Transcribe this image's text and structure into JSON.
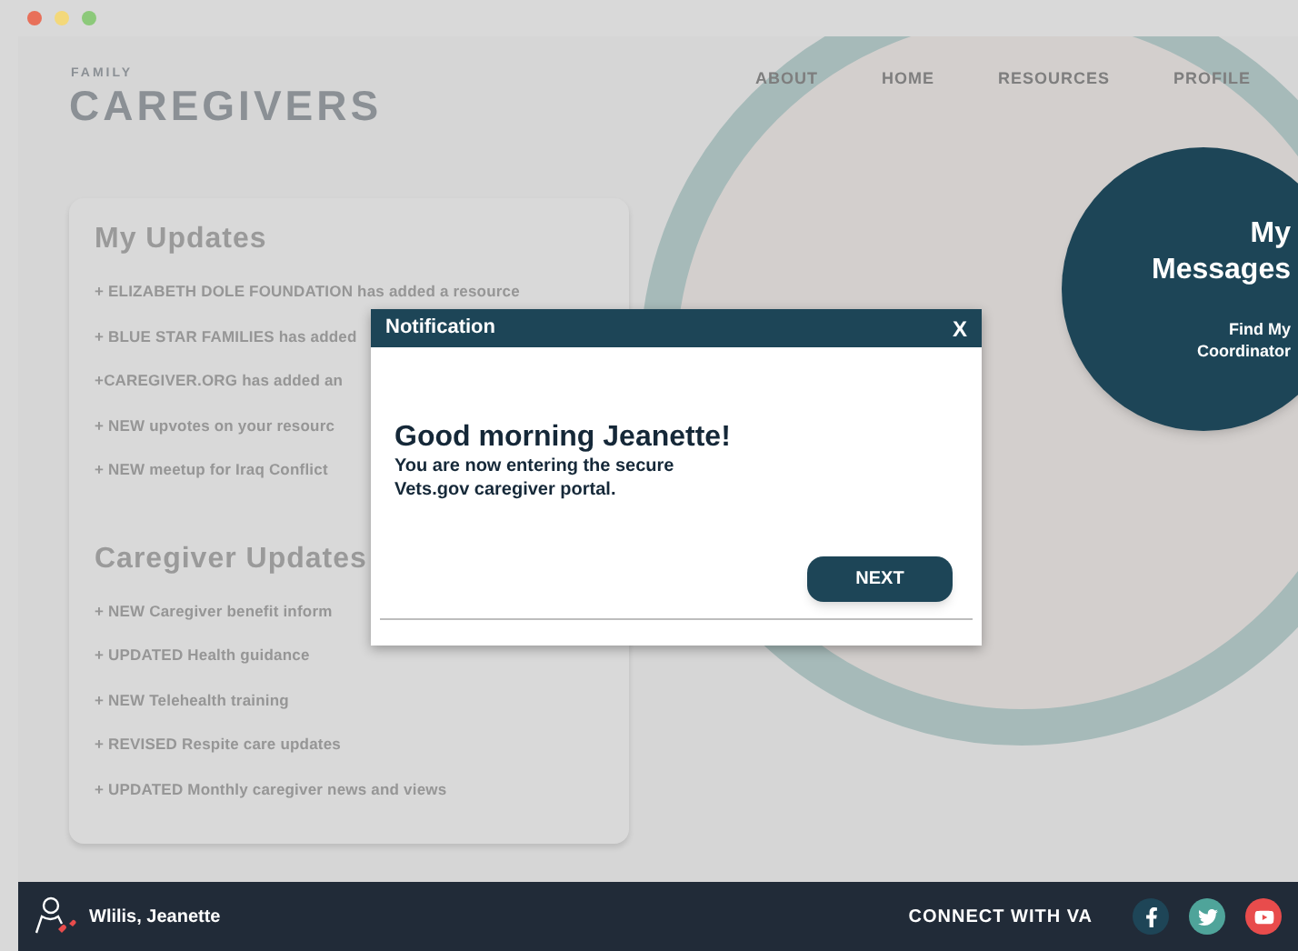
{
  "logo": {
    "small": "FAMILY",
    "large": "CAREGIVERS"
  },
  "nav": [
    {
      "label": "ABOUT"
    },
    {
      "label": "HOME"
    },
    {
      "label": "RESOURCES"
    },
    {
      "label": "PROFILE"
    }
  ],
  "messages": {
    "title": "My Messages",
    "link": "Find My Coordinator"
  },
  "sections": [
    {
      "title": "My Updates",
      "items": [
        "+ ELIZABETH DOLE FOUNDATION has added a resource",
        "+ BLUE STAR FAMILIES has added",
        "+CAREGIVER.ORG has added an",
        "+ NEW upvotes on your resourc",
        "+ NEW meetup for Iraq Conflict"
      ]
    },
    {
      "title": "Caregiver Updates",
      "items": [
        "+ NEW Caregiver benefit inform",
        "+ UPDATED Health guidance",
        "+ NEW Telehealth training",
        "+ REVISED Respite care updates",
        "+ UPDATED Monthly caregiver news and views"
      ]
    }
  ],
  "dialog": {
    "title": "Notification",
    "close": "X",
    "greeting": "Good morning Jeanette!",
    "message": "You are now entering the secure Vets.gov caregiver portal.",
    "button": "NEXT"
  },
  "footer": {
    "user": "Wlilis, Jeanette",
    "connect": "CONNECT WITH VA",
    "social": [
      {
        "kind": "facebook",
        "color": "#1e4557"
      },
      {
        "kind": "twitter",
        "color": "#4fa49a"
      },
      {
        "kind": "youtube",
        "color": "#e84c4c"
      }
    ]
  }
}
